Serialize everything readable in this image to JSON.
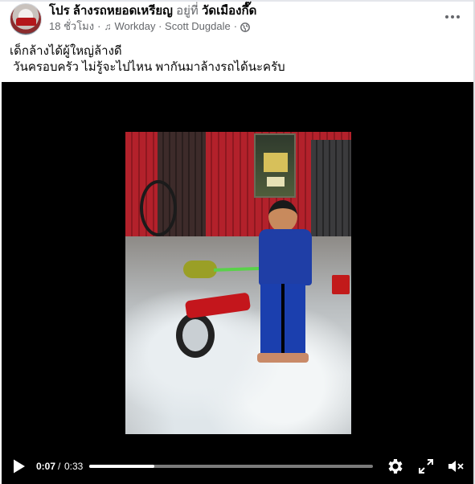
{
  "post": {
    "author": "โปร ล้างรถหยอดเหรียญ",
    "location_prefix": "อยู่ที่",
    "location": "วัดเมืองกึ๊ด",
    "time": "18 ชั่วโมง",
    "separator": "·",
    "music": "Workday · Scott Dugdale",
    "privacy_icon": "globe-icon",
    "more_icon": "more-icon"
  },
  "caption": {
    "line1": "เด็กล้างได้ผู้ใหญ่ล้างดี",
    "line2": " วันครอบครัว ไม่รู้จะไปไหน พากันมาล้างรถได้นะครับ"
  },
  "video": {
    "current_time": "0:07",
    "time_separator": "/",
    "duration": "0:33",
    "progress_fraction": 0.23,
    "play_icon": "play-icon",
    "settings_icon": "gear-icon",
    "fullscreen_icon": "fullscreen-icon",
    "volume_icon": "volume-muted-icon"
  },
  "colors": {
    "text": "#050505",
    "secondary_text": "#65676b",
    "video_bg": "#000000",
    "control_text": "#ffffff"
  }
}
